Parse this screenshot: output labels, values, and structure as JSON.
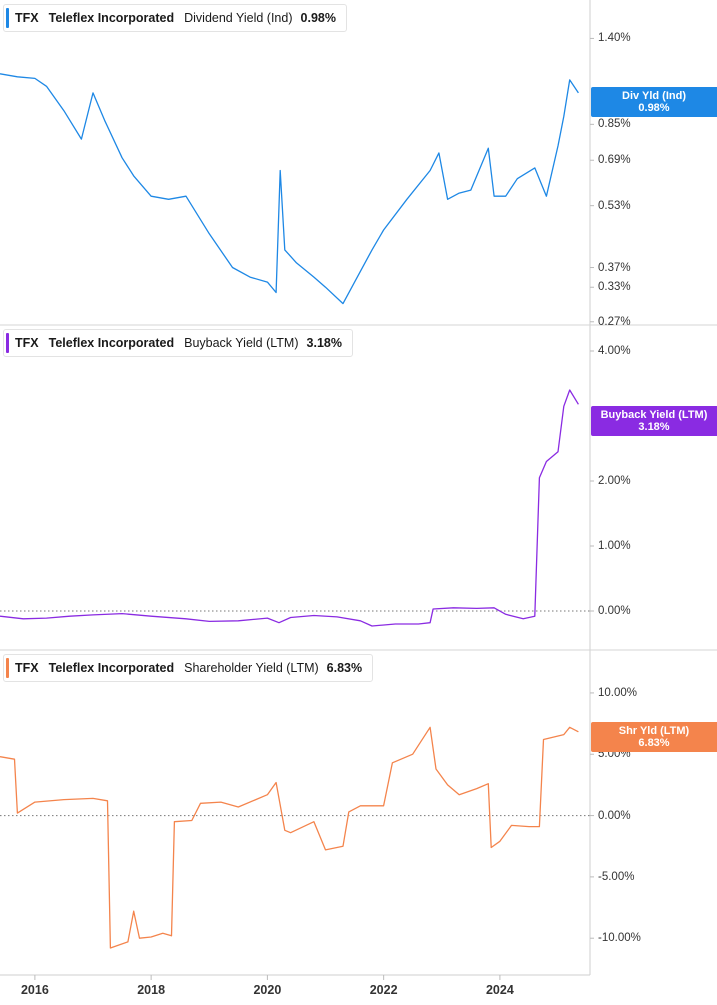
{
  "legends": [
    {
      "ticker": "TFX",
      "name": "Teleflex Incorporated",
      "metric": "Dividend Yield (Ind)",
      "value": "0.98%"
    },
    {
      "ticker": "TFX",
      "name": "Teleflex Incorporated",
      "metric": "Buyback Yield (LTM)",
      "value": "3.18%"
    },
    {
      "ticker": "TFX",
      "name": "Teleflex Incorporated",
      "metric": "Shareholder Yield (LTM)",
      "value": "6.83%"
    }
  ],
  "flags": [
    {
      "label": "Div Yld (Ind)",
      "value": "0.98%",
      "color": "#1e88e5"
    },
    {
      "label": "Buyback Yield (LTM)",
      "value": "3.18%",
      "color": "#8a2be2"
    },
    {
      "label": "Shr Yld (LTM)",
      "value": "6.83%",
      "color": "#f4844c"
    }
  ],
  "chart_data": [
    {
      "type": "line",
      "color": "#1e88e5",
      "scale": "log",
      "ylim": [
        0.265,
        1.75
      ],
      "yticks": [
        "1.40%",
        "0.85%",
        "0.69%",
        "0.53%",
        "0.37%",
        "0.33%",
        "0.27%"
      ],
      "series": [
        {
          "name": "Dividend Yield (Ind)",
          "x": [
            2015.4,
            2015.7,
            2016.0,
            2016.2,
            2016.5,
            2016.8,
            2017.0,
            2017.2,
            2017.5,
            2017.7,
            2018.0,
            2018.3,
            2018.6,
            2019.0,
            2019.4,
            2019.7,
            2020.0,
            2020.15,
            2020.22,
            2020.3,
            2020.5,
            2020.8,
            2021.0,
            2021.3,
            2021.5,
            2021.8,
            2022.0,
            2022.4,
            2022.8,
            2022.95,
            2023.1,
            2023.3,
            2023.5,
            2023.8,
            2023.9,
            2024.1,
            2024.3,
            2024.6,
            2024.8,
            2025.0,
            2025.1,
            2025.2,
            2025.35
          ],
          "values": [
            1.14,
            1.12,
            1.11,
            1.06,
            0.92,
            0.78,
            1.02,
            0.87,
            0.7,
            0.63,
            0.56,
            0.55,
            0.56,
            0.45,
            0.37,
            0.35,
            0.34,
            0.32,
            0.65,
            0.41,
            0.38,
            0.35,
            0.33,
            0.3,
            0.34,
            0.41,
            0.46,
            0.55,
            0.65,
            0.72,
            0.55,
            0.57,
            0.58,
            0.74,
            0.56,
            0.56,
            0.62,
            0.66,
            0.56,
            0.75,
            0.89,
            1.1,
            1.02
          ]
        }
      ]
    },
    {
      "type": "line",
      "color": "#8a2be2",
      "ylim": [
        -0.6,
        4.4
      ],
      "yticks": [
        "4.00%",
        "2.00%",
        "1.00%",
        "0.00%"
      ],
      "series": [
        {
          "name": "Buyback Yield (LTM)",
          "x": [
            2015.4,
            2015.8,
            2016.2,
            2016.6,
            2017.0,
            2017.5,
            2018.0,
            2018.6,
            2019.0,
            2019.5,
            2020.0,
            2020.2,
            2020.4,
            2020.8,
            2021.2,
            2021.6,
            2021.8,
            2022.2,
            2022.6,
            2022.8,
            2022.85,
            2023.2,
            2023.6,
            2023.9,
            2024.1,
            2024.4,
            2024.6,
            2024.68,
            2024.8,
            2025.0,
            2025.1,
            2025.2,
            2025.35
          ],
          "values": [
            -0.08,
            -0.12,
            -0.11,
            -0.08,
            -0.06,
            -0.04,
            -0.08,
            -0.12,
            -0.16,
            -0.15,
            -0.11,
            -0.18,
            -0.1,
            -0.07,
            -0.09,
            -0.15,
            -0.23,
            -0.2,
            -0.2,
            -0.18,
            0.03,
            0.05,
            0.04,
            0.05,
            -0.05,
            -0.12,
            -0.08,
            2.05,
            2.3,
            2.45,
            3.15,
            3.4,
            3.18
          ]
        }
      ]
    },
    {
      "type": "line",
      "color": "#f4844c",
      "ylim": [
        -13.0,
        13.5
      ],
      "yticks": [
        "10.00%",
        "5.00%",
        "0.00%",
        "-5.00%",
        "-10.00%"
      ],
      "series": [
        {
          "name": "Shareholder Yield (LTM)",
          "x": [
            2015.4,
            2015.65,
            2015.7,
            2016.0,
            2016.5,
            2017.0,
            2017.25,
            2017.3,
            2017.6,
            2017.7,
            2017.8,
            2018.0,
            2018.2,
            2018.35,
            2018.4,
            2018.7,
            2018.85,
            2019.2,
            2019.5,
            2019.8,
            2020.0,
            2020.15,
            2020.3,
            2020.4,
            2020.8,
            2021.0,
            2021.3,
            2021.4,
            2021.6,
            2022.0,
            2022.15,
            2022.5,
            2022.8,
            2022.9,
            2023.1,
            2023.3,
            2023.6,
            2023.8,
            2023.85,
            2024.0,
            2024.2,
            2024.5,
            2024.68,
            2024.75,
            2025.1,
            2025.2,
            2025.35
          ],
          "values": [
            4.8,
            4.6,
            0.2,
            1.1,
            1.3,
            1.4,
            1.2,
            -10.8,
            -10.3,
            -7.8,
            -10.0,
            -9.9,
            -9.6,
            -9.8,
            -0.5,
            -0.4,
            1.0,
            1.1,
            0.7,
            1.3,
            1.7,
            2.7,
            -1.2,
            -1.4,
            -0.5,
            -2.8,
            -2.5,
            0.3,
            0.8,
            0.8,
            4.3,
            5.0,
            7.2,
            3.8,
            2.5,
            1.7,
            2.2,
            2.6,
            -2.6,
            -2.1,
            -0.8,
            -0.9,
            -0.9,
            6.2,
            6.6,
            7.2,
            6.83
          ]
        }
      ]
    }
  ],
  "x_axis": {
    "xlim": [
      2015.4,
      2025.55
    ],
    "ticks": [
      "2016",
      "2018",
      "2020",
      "2022",
      "2024"
    ]
  }
}
